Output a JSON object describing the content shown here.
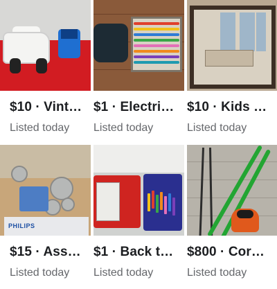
{
  "listings": [
    {
      "price_title": "$10 · Vint…",
      "status": "Listed today",
      "image": "red-toy-car"
    },
    {
      "price_title": "$1 · Electri…",
      "status": "Listed today",
      "image": "markers-box"
    },
    {
      "price_title": "$10 · Kids …",
      "status": "Listed today",
      "image": "framed-print"
    },
    {
      "price_title": "$15 · Ass…",
      "status": "Listed today",
      "image": "philips-box",
      "image_text": "PHILIPS"
    },
    {
      "price_title": "$1 · Back t…",
      "status": "Listed today",
      "image": "red-bin-crayons"
    },
    {
      "price_title": "$800 · Cor…",
      "status": "Listed today",
      "image": "skis"
    }
  ]
}
